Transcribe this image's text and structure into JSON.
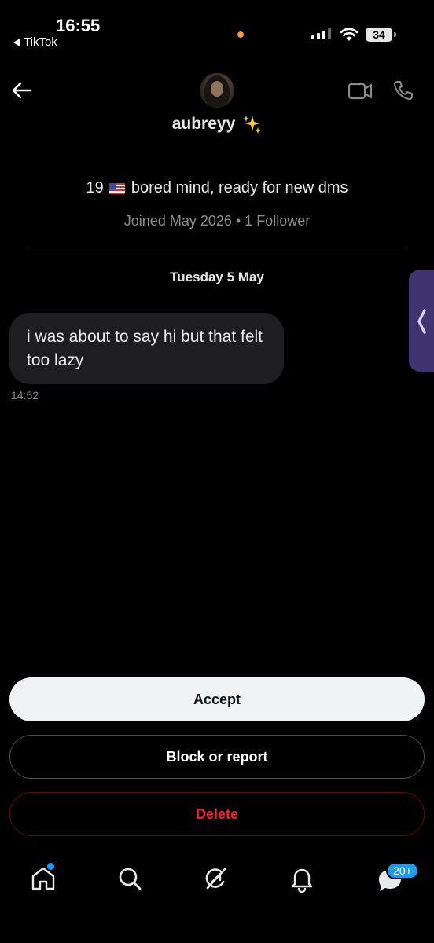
{
  "status_bar": {
    "time": "16:55",
    "back_app": "TikTok",
    "battery": "34"
  },
  "header": {
    "name": "aubreyy",
    "name_emoji": "✨",
    "avatar_icon": "user-avatar"
  },
  "profile": {
    "bio_age": "19",
    "bio_text": "bored mind, ready for new dms",
    "joined": "Joined May 2026 • 1 Follower"
  },
  "conversation": {
    "date_separator": "Tuesday 5 May",
    "messages": [
      {
        "text": "i was about to say hi but that felt too lazy",
        "time": "14:52"
      }
    ]
  },
  "actions": {
    "accept_label": "Accept",
    "block_label": "Block or report",
    "delete_label": "Delete"
  },
  "bottom_nav": {
    "messages_badge": "20+",
    "items": [
      "home-icon",
      "search-icon",
      "grok-icon",
      "notifications-icon",
      "messages-icon"
    ]
  },
  "colors": {
    "background": "#000000",
    "accent": "#1d9bf0",
    "danger": "#f4212e",
    "side_handle": "#3f3470"
  }
}
